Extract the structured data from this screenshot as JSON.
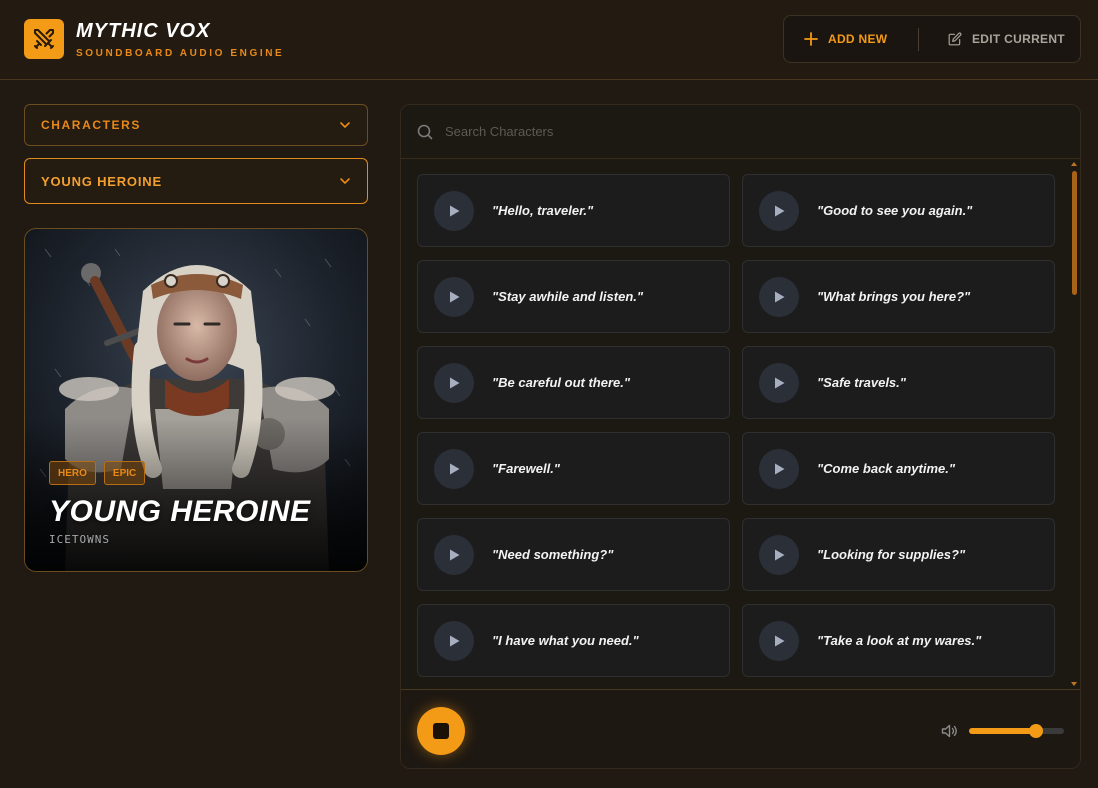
{
  "app": {
    "title": "MYTHIC VOX",
    "subtitle": "SOUNDBOARD AUDIO ENGINE",
    "logo_icon": "crossed-swords-icon"
  },
  "header": {
    "add_label": "ADD NEW",
    "edit_label": "EDIT CURRENT"
  },
  "filters": {
    "category": "CHARACTERS",
    "character": "YOUNG HEROINE"
  },
  "character_card": {
    "tags": [
      "HERO",
      "EPIC"
    ],
    "name": "YOUNG HEROINE",
    "location": "ICETOWNS"
  },
  "search": {
    "placeholder": "Search Characters"
  },
  "lines": [
    "\"Hello, traveler.\"",
    "\"Good to see you again.\"",
    "\"Stay awhile and listen.\"",
    "\"What brings you here?\"",
    "\"Be careful out there.\"",
    "\"Safe travels.\"",
    "\"Farewell.\"",
    "\"Come back anytime.\"",
    "\"Need something?\"",
    "\"Looking for supplies?\"",
    "\"I have what you need.\"",
    "\"Take a look at my wares.\""
  ],
  "player": {
    "volume": 0.71
  },
  "colors": {
    "accent": "#f39a16",
    "background": "#211a12",
    "panel": "#1c1812"
  }
}
